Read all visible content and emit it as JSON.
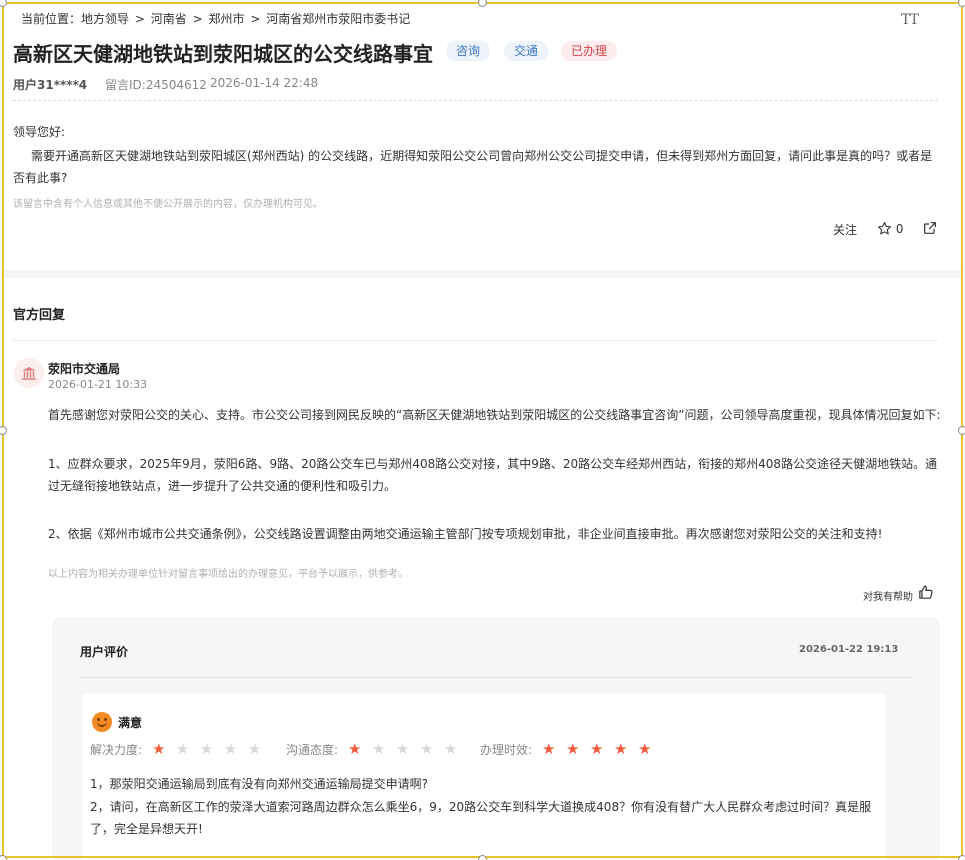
{
  "breadcrumb": [
    "当前位置：地方领导",
    ">",
    "河南省",
    ">",
    "郑州市",
    ">",
    "河南省郑州市荥阳市委书记"
  ],
  "post": {
    "title": "高新区天健湖地铁站到荥阳城区的公交线路事宜",
    "tags": [
      "咨询",
      "交通",
      "已办理"
    ],
    "user": "用户31****4",
    "id_label": "留言ID:24504612",
    "time": "2026-01-14 22:48",
    "greeting": "领导您好:",
    "body": "需要开通高新区天健湖地铁站到荥阳城区(郑州西站) 的公交线路，近期得知荥阳公交公司曾向郑州公交公司提交申请，但未得到郑州方面回复，请问此事是真的吗？或者是否有此事?",
    "privacy_note": "该留言中含有个人信息或其他不便公开展示的内容，仅办理机构可见。",
    "follow_label": "关注",
    "star_count": "0"
  },
  "reply": {
    "heading": "官方回复",
    "dept": "荥阳市交通局",
    "time": "2026-01-21 10:33",
    "paragraphs": [
      "首先感谢您对荥阳公交的关心、支持。市公交公司接到网民反映的“高新区天健湖地铁站到荥阳城区的公交线路事宜咨询”问题，公司领导高度重视，现具体情况回复如下:",
      "1、应群众要求，2025年9月，荥阳6路、9路、20路公交车已与郑州408路公交对接，其中9路、20路公交车经郑州西站，衔接的郑州408路公交途径天健湖地铁站。通过无缝衔接地铁站点，进一步提升了公共交通的便利性和吸引力。",
      "2、依据《郑州市城市公共交通条例》，公交线路设置调整由两地交通运输主管部门按专项规划审批，非企业间直接审批。再次感谢您对荥阳公交的关注和支持!"
    ],
    "note": "以上内容为相关办理单位针对留言事项给出的办理意见，平台予以展示，供参考。",
    "helpful_label": "对我有帮助"
  },
  "evaluation": {
    "heading": "用户评价",
    "time": "2026-01-22 19:13",
    "satisfaction": "满意",
    "ratings": [
      {
        "label": "解决力度:",
        "score": 1
      },
      {
        "label": "沟通态度:",
        "score": 1
      },
      {
        "label": "办理时效:",
        "score": 5
      }
    ],
    "comments": [
      "1，那荥阳交通运输局到底有没有向郑州交通运输局提交申请啊?",
      "2，请问，在高新区工作的荥泽大道索河路周边群众怎么乘坐6，9，20路公交车到科学大道换成408？你有没有替广大人民群众考虑过时间？真是服了，完全是异想天开!"
    ]
  },
  "colors": {
    "accent_red": "#f35b3a",
    "frame": "#e8c42a"
  }
}
